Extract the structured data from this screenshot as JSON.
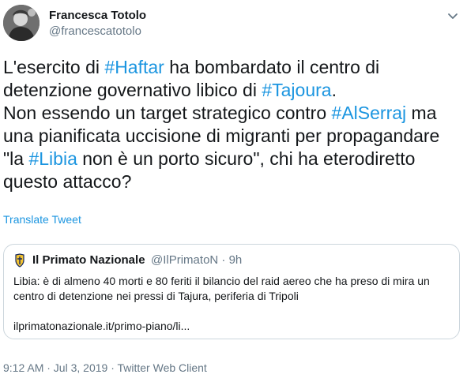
{
  "author": {
    "name": "Francesca Totolo",
    "handle": "@francescatotolo"
  },
  "tweet": {
    "p1": "L'esercito di ",
    "p2": "#Haftar",
    "p3": " ha bombardato il centro di\ndetenzione governativo libico di ",
    "p4": "#Tajoura",
    "p5": ".\nNon essendo un target strategico contro ",
    "p6": "#AlSerraj",
    "p7": " ma\nuna pianificata uccisione di migranti per propagandare\n\"la ",
    "p8": "#Libia",
    "p9": " non è un porto sicuro\", chi ha eterodiretto\nquesto attacco?"
  },
  "translate_label": "Translate Tweet",
  "quote": {
    "name": "Il Primato Nazionale",
    "handle_time": "@IlPrimatoN · 9h",
    "text": "Libia: è di almeno 40 morti e 80 feriti il bilancio del raid aereo che ha preso di mira un centro di detenzione nei pressi di Tajura, periferia di Tripoli",
    "link": "ilprimatonazionale.it/primo-piano/li..."
  },
  "meta": "9:12 AM · Jul 3, 2019 · Twitter Web Client",
  "colors": {
    "link": "#1b95e0",
    "secondary": "#657786",
    "border": "#ccd6dd"
  },
  "icons": {
    "more": "chevron-down-icon",
    "quote_logo": "primato-logo-icon"
  }
}
